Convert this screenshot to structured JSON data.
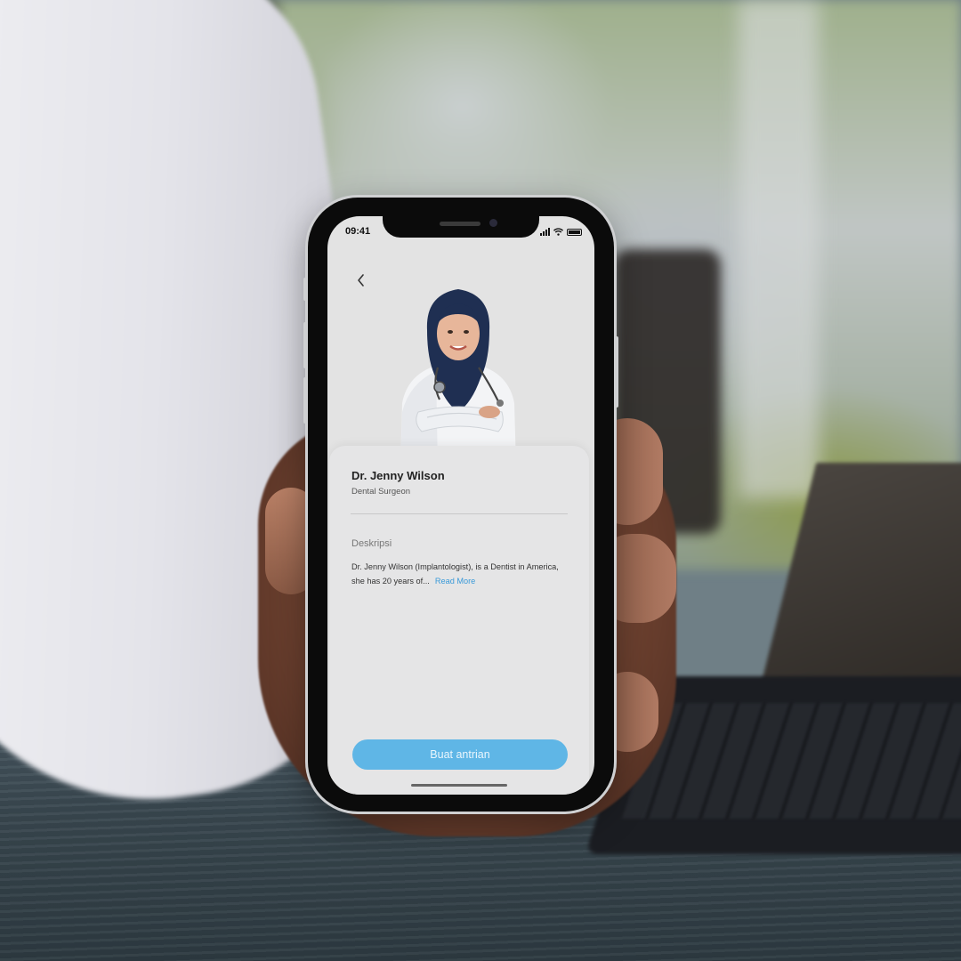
{
  "status_bar": {
    "time": "09:41",
    "icons": [
      "cellular-signal-icon",
      "wifi-icon",
      "battery-icon"
    ]
  },
  "header": {
    "back_icon": "chevron-left-icon"
  },
  "doctor": {
    "name": "Dr. Jenny Wilson",
    "specialty": "Dental Surgeon",
    "photo": "doctor-portrait"
  },
  "description": {
    "heading": "Deskripsi",
    "text": "Dr. Jenny Wilson (Implantologist),  is a Dentist in America, she has 20 years of...",
    "read_more_label": "Read More"
  },
  "actions": {
    "primary_label": "Buat antrian"
  },
  "colors": {
    "accent": "#5fb6e6",
    "link": "#3a9ad9",
    "screen_bg": "#e3e3e3"
  }
}
